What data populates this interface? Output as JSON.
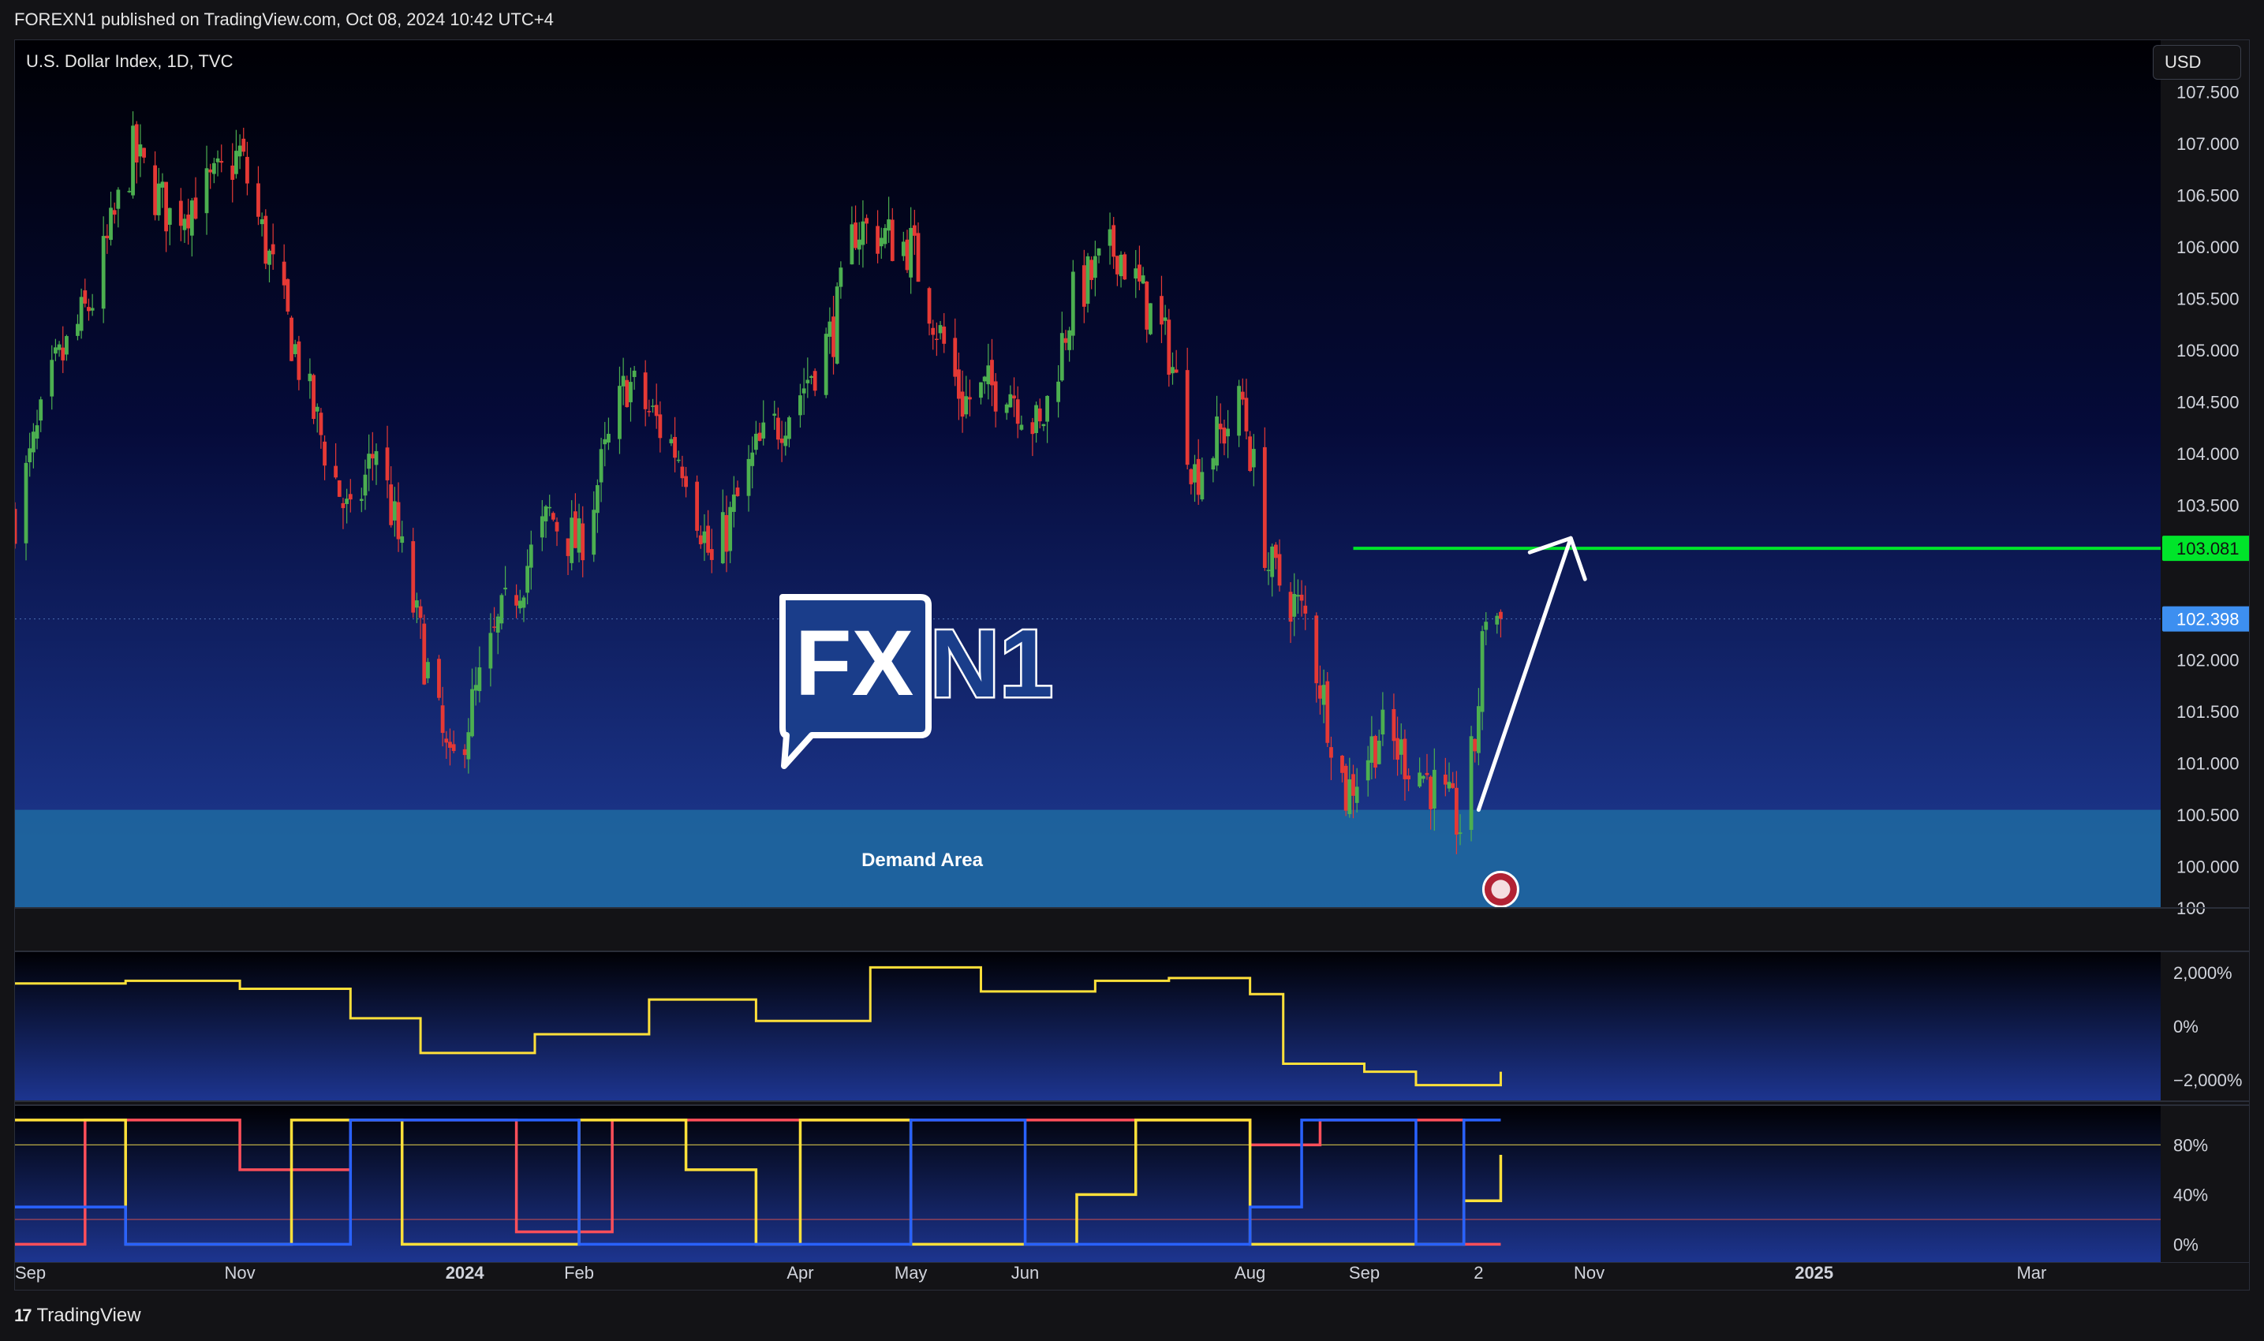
{
  "header": {
    "publish_line": "FOREXN1 published on TradingView.com, Oct 08, 2024 10:42 UTC+4"
  },
  "chart_header": {
    "symbol_line": "U.S. Dollar Index, 1D, TVC",
    "currency_button": "USD"
  },
  "footer": {
    "brand": "TradingView",
    "brand_icon": "tradingview-logo-icon"
  },
  "logo": {
    "text_a": "FX",
    "text_b": "N1"
  },
  "colors": {
    "up": "#26a69a",
    "green_candle": "#4caf50",
    "red_candle": "#e53935",
    "target_line": "#00e52a",
    "price_badge": "#3d8ff0",
    "demand_zone": "#1e6aa0",
    "osc_yellow": "#ffe03a",
    "osc_red": "#ff4f5a",
    "osc_blue": "#2962ff"
  },
  "chart_data": [
    {
      "type": "candlestick",
      "title": "U.S. Dollar Index, 1D, TVC",
      "ylim": [
        99.6,
        108.0
      ],
      "y_ticks": [
        "107.500",
        "107.000",
        "106.500",
        "106.000",
        "105.500",
        "105.000",
        "104.500",
        "104.000",
        "103.500",
        "102.000",
        "101.500",
        "101.000",
        "100.500",
        "100.000",
        "100"
      ],
      "y_tick_values": [
        107.5,
        107.0,
        106.5,
        106.0,
        105.5,
        105.0,
        104.5,
        104.0,
        103.5,
        102.0,
        101.5,
        101.0,
        100.5,
        100.0,
        99.6
      ],
      "x_ticks": [
        "Sep",
        "Nov",
        "2024",
        "Feb",
        "Apr",
        "May",
        "Jun",
        "Aug",
        "Sep",
        "2",
        "Nov",
        "2025",
        "Mar"
      ],
      "x_tick_dates": [
        "2023-09-01",
        "2023-11-01",
        "2024-01-01",
        "2024-02-01",
        "2024-04-01",
        "2024-05-01",
        "2024-06-01",
        "2024-08-01",
        "2024-09-01",
        "2024-10-02",
        "2024-11-01",
        "2025-01-01",
        "2025-03-01"
      ],
      "x_range": [
        "2023-09-01",
        "2025-04-05"
      ],
      "price_path": [
        {
          "date": "2023-09-01",
          "close": 103.4
        },
        {
          "date": "2023-09-12",
          "close": 104.8
        },
        {
          "date": "2023-09-22",
          "close": 105.5
        },
        {
          "date": "2023-10-03",
          "close": 106.9
        },
        {
          "date": "2023-10-13",
          "close": 106.3
        },
        {
          "date": "2023-10-25",
          "close": 106.6
        },
        {
          "date": "2023-11-01",
          "close": 106.9
        },
        {
          "date": "2023-11-08",
          "close": 106.0
        },
        {
          "date": "2023-11-20",
          "close": 104.5
        },
        {
          "date": "2023-12-01",
          "close": 103.3
        },
        {
          "date": "2023-12-08",
          "close": 104.1
        },
        {
          "date": "2023-12-20",
          "close": 102.2
        },
        {
          "date": "2023-12-28",
          "close": 100.9
        },
        {
          "date": "2024-01-10",
          "close": 102.3
        },
        {
          "date": "2024-01-24",
          "close": 103.4
        },
        {
          "date": "2024-02-01",
          "close": 103.1
        },
        {
          "date": "2024-02-14",
          "close": 104.7
        },
        {
          "date": "2024-03-01",
          "close": 103.9
        },
        {
          "date": "2024-03-08",
          "close": 102.9
        },
        {
          "date": "2024-03-20",
          "close": 104.0
        },
        {
          "date": "2024-04-01",
          "close": 104.6
        },
        {
          "date": "2024-04-10",
          "close": 105.2
        },
        {
          "date": "2024-04-16",
          "close": 106.2
        },
        {
          "date": "2024-05-01",
          "close": 106.0
        },
        {
          "date": "2024-05-15",
          "close": 104.5
        },
        {
          "date": "2024-05-27",
          "close": 104.7
        },
        {
          "date": "2024-06-05",
          "close": 104.2
        },
        {
          "date": "2024-06-14",
          "close": 105.5
        },
        {
          "date": "2024-06-26",
          "close": 106.0
        },
        {
          "date": "2024-07-10",
          "close": 105.0
        },
        {
          "date": "2024-07-17",
          "close": 103.8
        },
        {
          "date": "2024-07-30",
          "close": 104.5
        },
        {
          "date": "2024-08-06",
          "close": 102.9
        },
        {
          "date": "2024-08-16",
          "close": 102.4
        },
        {
          "date": "2024-08-27",
          "close": 100.7
        },
        {
          "date": "2024-09-05",
          "close": 101.3
        },
        {
          "date": "2024-09-17",
          "close": 100.9
        },
        {
          "date": "2024-09-27",
          "close": 100.4
        },
        {
          "date": "2024-10-01",
          "close": 101.2
        },
        {
          "date": "2024-10-04",
          "close": 102.5
        },
        {
          "date": "2024-10-08",
          "close": 102.4
        }
      ],
      "period_high": 107.35,
      "period_low": 100.16,
      "last_price": "102.398",
      "last_price_value": 102.398,
      "target_price": "103.081",
      "target_price_value": 103.081,
      "target_line_start": "2024-08-29",
      "demand_area": {
        "label": "Demand Area",
        "from": 99.6,
        "to": 100.55
      },
      "arrow": {
        "from_date": "2024-10-02",
        "from_price": 100.55,
        "to_date": "2024-10-27",
        "to_price": 103.18
      }
    },
    {
      "type": "line",
      "y_ticks": [
        "2,000%",
        "0%",
        "−2,000%"
      ],
      "y_tick_values": [
        2000,
        0,
        -2000
      ],
      "ylim": [
        -2800,
        2800
      ],
      "series": [
        {
          "color": "#ffe03a",
          "points": [
            {
              "date": "2023-09-01",
              "value": 1600
            },
            {
              "date": "2023-10-01",
              "value": 1700
            },
            {
              "date": "2023-11-01",
              "value": 1400
            },
            {
              "date": "2023-12-01",
              "value": 300
            },
            {
              "date": "2023-12-20",
              "value": -1000
            },
            {
              "date": "2024-01-20",
              "value": -300
            },
            {
              "date": "2024-02-20",
              "value": 1000
            },
            {
              "date": "2024-03-20",
              "value": 200
            },
            {
              "date": "2024-04-20",
              "value": 2200
            },
            {
              "date": "2024-05-20",
              "value": 1300
            },
            {
              "date": "2024-06-20",
              "value": 1700
            },
            {
              "date": "2024-07-10",
              "value": 1800
            },
            {
              "date": "2024-08-01",
              "value": 1200
            },
            {
              "date": "2024-08-10",
              "value": -1400
            },
            {
              "date": "2024-09-01",
              "value": -1700
            },
            {
              "date": "2024-09-15",
              "value": -2200
            },
            {
              "date": "2024-10-08",
              "value": -1700
            }
          ]
        }
      ]
    },
    {
      "type": "line",
      "y_ticks": [
        "80%",
        "40%",
        "0%"
      ],
      "y_tick_values": [
        80,
        40,
        0
      ],
      "reference_lines": [
        80,
        20
      ],
      "ylim": [
        -15,
        112
      ],
      "series": [
        {
          "color": "#ff4f5a",
          "points": [
            {
              "date": "2023-09-01",
              "value": 0
            },
            {
              "date": "2023-09-20",
              "value": 100
            },
            {
              "date": "2023-11-01",
              "value": 60
            },
            {
              "date": "2023-12-01",
              "value": 100
            },
            {
              "date": "2024-01-15",
              "value": 10
            },
            {
              "date": "2024-02-10",
              "value": 100
            },
            {
              "date": "2024-03-10",
              "value": 100
            },
            {
              "date": "2024-04-15",
              "value": 100
            },
            {
              "date": "2024-05-15",
              "value": 100
            },
            {
              "date": "2024-06-15",
              "value": 100
            },
            {
              "date": "2024-08-01",
              "value": 80
            },
            {
              "date": "2024-08-20",
              "value": 100
            },
            {
              "date": "2024-09-25",
              "value": 100
            },
            {
              "date": "2024-09-28",
              "value": 0
            },
            {
              "date": "2024-10-08",
              "value": 0
            }
          ]
        },
        {
          "color": "#ffe03a",
          "points": [
            {
              "date": "2023-09-01",
              "value": 100
            },
            {
              "date": "2023-10-01",
              "value": 0
            },
            {
              "date": "2023-11-15",
              "value": 100
            },
            {
              "date": "2023-12-15",
              "value": 0
            },
            {
              "date": "2024-02-01",
              "value": 100
            },
            {
              "date": "2024-03-01",
              "value": 60
            },
            {
              "date": "2024-03-20",
              "value": 0
            },
            {
              "date": "2024-04-01",
              "value": 100
            },
            {
              "date": "2024-05-01",
              "value": 0
            },
            {
              "date": "2024-06-15",
              "value": 40
            },
            {
              "date": "2024-07-01",
              "value": 100
            },
            {
              "date": "2024-08-01",
              "value": 0
            },
            {
              "date": "2024-08-20",
              "value": 0
            },
            {
              "date": "2024-09-28",
              "value": 35
            },
            {
              "date": "2024-10-08",
              "value": 72
            }
          ]
        },
        {
          "color": "#2962ff",
          "points": [
            {
              "date": "2023-09-01",
              "value": 30
            },
            {
              "date": "2023-10-01",
              "value": 0
            },
            {
              "date": "2023-11-15",
              "value": 0
            },
            {
              "date": "2023-12-01",
              "value": 100
            },
            {
              "date": "2024-01-01",
              "value": 100
            },
            {
              "date": "2024-02-01",
              "value": 0
            },
            {
              "date": "2024-03-01",
              "value": 0
            },
            {
              "date": "2024-04-01",
              "value": 0
            },
            {
              "date": "2024-05-01",
              "value": 100
            },
            {
              "date": "2024-06-01",
              "value": 0
            },
            {
              "date": "2024-07-10",
              "value": 0
            },
            {
              "date": "2024-08-01",
              "value": 30
            },
            {
              "date": "2024-08-15",
              "value": 100
            },
            {
              "date": "2024-09-15",
              "value": 0
            },
            {
              "date": "2024-09-28",
              "value": 100
            },
            {
              "date": "2024-10-08",
              "value": 100
            }
          ]
        }
      ]
    }
  ]
}
